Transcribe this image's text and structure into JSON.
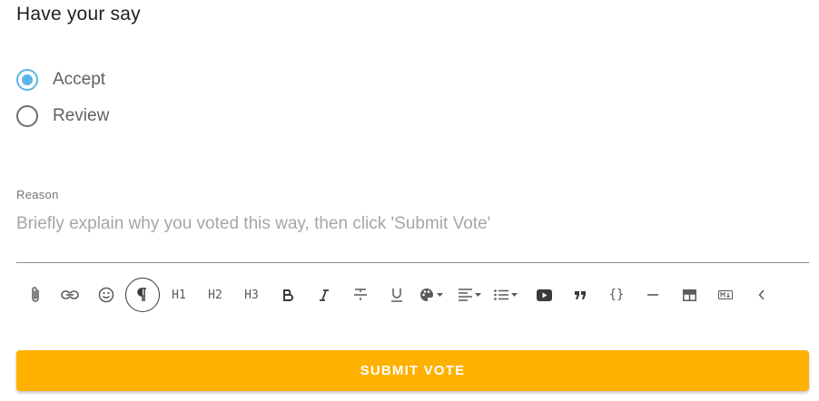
{
  "section": {
    "title": "Have your say"
  },
  "vote_options": [
    {
      "label": "Accept",
      "selected": true
    },
    {
      "label": "Review",
      "selected": false
    }
  ],
  "reason": {
    "label": "Reason",
    "value": "",
    "placeholder": "Briefly explain why you voted this way, then click 'Submit Vote'"
  },
  "toolbar": {
    "h1_label": "H1",
    "h2_label": "H2",
    "h3_label": "H3",
    "code_label": "{}",
    "icons": [
      "attach-icon",
      "link-icon",
      "emoji-icon",
      "paragraph-icon",
      "h1",
      "h2",
      "h3",
      "bold-icon",
      "italic-icon",
      "strikethrough-icon",
      "underline-icon",
      "text-color-icon",
      "align-icon",
      "list-icon",
      "video-icon",
      "quote-icon",
      "code-icon",
      "horizontal-rule-icon",
      "table-icon",
      "markdown-icon",
      "collapse-icon"
    ]
  },
  "submit": {
    "label": "SUBMIT VOTE"
  },
  "colors": {
    "accent": "#5bb4ea",
    "submit_bg": "#ffb100"
  }
}
